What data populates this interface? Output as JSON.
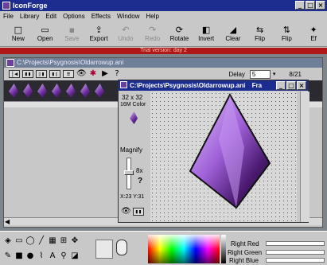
{
  "app": {
    "title": "IconForge",
    "caption_min": "_",
    "caption_max": "□",
    "caption_close": "×"
  },
  "menu": [
    "File",
    "Library",
    "Edit",
    "Options",
    "Effects",
    "Window",
    "Help"
  ],
  "toolbar": [
    {
      "label": "New",
      "icon": "new-file-icon",
      "glyph": "□",
      "enabled": true
    },
    {
      "label": "Open",
      "icon": "open-folder-icon",
      "glyph": "▭",
      "enabled": true
    },
    {
      "label": "Save",
      "icon": "save-icon",
      "glyph": "▪",
      "enabled": false
    },
    {
      "label": "Export",
      "icon": "export-icon",
      "glyph": "⇪",
      "enabled": true
    },
    {
      "label": "Undo",
      "icon": "undo-icon",
      "glyph": "↶",
      "enabled": false
    },
    {
      "label": "Redo",
      "icon": "redo-icon",
      "glyph": "↷",
      "enabled": false
    },
    {
      "label": "Rotate",
      "icon": "rotate-icon",
      "glyph": "⟳",
      "enabled": true
    },
    {
      "label": "Invert",
      "icon": "invert-icon",
      "glyph": "◧",
      "enabled": true
    },
    {
      "label": "Clear",
      "icon": "clear-icon",
      "glyph": "◢",
      "enabled": true
    },
    {
      "label": "Flip",
      "icon": "flip-horizontal-icon",
      "glyph": "⇆",
      "enabled": true
    },
    {
      "label": "Flip",
      "icon": "flip-vertical-icon",
      "glyph": "⇅",
      "enabled": true
    },
    {
      "label": "Ef",
      "icon": "effects-icon",
      "glyph": "✦",
      "enabled": true
    }
  ],
  "trial_banner": "Trial version: day 2",
  "doc": {
    "title": "C:\\Projects\\Psygnosis\\Oldarrowup.ani",
    "delay_label": "Delay",
    "delay_value": "5",
    "frame_counter": "8/21"
  },
  "editor": {
    "title": "C:\\Projects\\Psygnosis\\Oldarrowup.ani",
    "title_suffix": "Fra",
    "size": "32 x 32",
    "colors": "16M Color",
    "magnify_label": "Magnify",
    "magnify_value": "8x",
    "help_glyph": "?",
    "coords": "X:23 Y:31"
  },
  "palette": {
    "right_red": "Right Red",
    "right_green": "Right Green",
    "right_blue": "Right Blue"
  },
  "colors": {
    "title_active": "#1c2d8f",
    "title_inactive": "#6f7f98",
    "trial_red": "#b01818",
    "gem_purple": "#7a3fa8"
  }
}
